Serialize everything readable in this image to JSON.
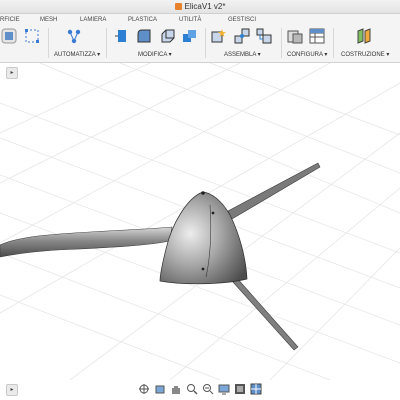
{
  "window": {
    "title": "ElicaV1 v2*"
  },
  "tabs": [
    "RFICIE",
    "MESH",
    "LAMIERA",
    "PLASTICA",
    "UTILITÀ",
    "GESTISCI"
  ],
  "toolbar_groups": [
    "AUTOMATIZZA ▾",
    "MODIFICA ▾",
    "ASSEMBLA ▾",
    "CONFIGURA ▾",
    "COSTRUZIONE ▾"
  ],
  "viewport": {
    "corner_button": "▸",
    "bottom_button": "▸"
  },
  "nav_icons": [
    "orbit-icon",
    "pan-icon",
    "hand-icon",
    "zoom-icon",
    "zoom-window-icon",
    "display-style-icon",
    "grid-icon",
    "viewports-icon"
  ],
  "colors": {
    "toolbar_bg": "#f4f4f4",
    "accent_blue": "#2d7fd3",
    "propeller": "#8c8c8c"
  }
}
